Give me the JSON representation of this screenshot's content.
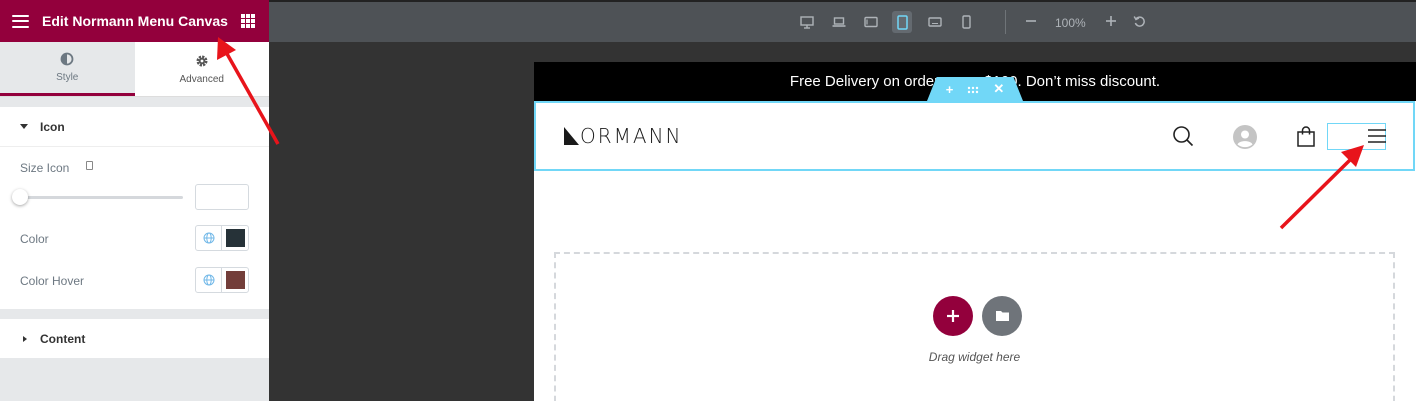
{
  "panel": {
    "title": "Edit Normann Menu Canvas",
    "tabs": [
      {
        "label": "Style",
        "icon": "contrast-icon",
        "active": true
      },
      {
        "label": "Advanced",
        "icon": "gear-icon",
        "active": false
      }
    ],
    "icon_section": {
      "title": "Icon",
      "size_label": "Size Icon",
      "size_value": "",
      "color_label": "Color",
      "color_value": "#263238",
      "hover_label": "Color Hover",
      "hover_value": "#733e3a"
    },
    "content_section": {
      "title": "Content"
    },
    "accent": "#93003c"
  },
  "toolbar": {
    "devices": [
      "desktop-icon",
      "laptop-icon",
      "tablet-landscape-icon",
      "tablet-icon",
      "mobile-landscape-icon",
      "mobile-icon"
    ],
    "active_device": "tablet-icon",
    "zoom": "100%"
  },
  "canvas": {
    "promo_text": "Free Delivery on orders over $100. Don’t miss discount.",
    "logo_text": "ORMANN",
    "drop_hint": "Drag widget here",
    "add_color": "#93003c",
    "template_color": "#6f747a"
  }
}
